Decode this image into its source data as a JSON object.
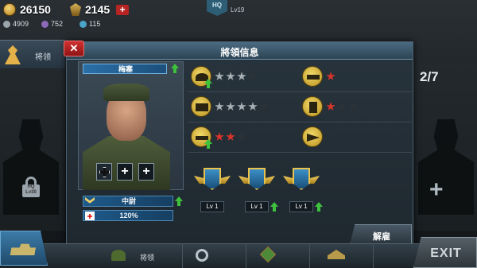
{
  "top_bar": {
    "gold": "26150",
    "medals": "2145",
    "resource_a": "4909",
    "resource_b": "752",
    "resource_c": "115",
    "hq_label": "HQ",
    "hq_level": "Lv19"
  },
  "left_tab": {
    "label": "将领"
  },
  "side": {
    "counter": "2/7",
    "lock_label": "HQ\nLv30"
  },
  "dialog": {
    "title": "將領信息",
    "close": "✕",
    "general_name": "梅塞",
    "rank": "中尉",
    "hp": "120%",
    "medal_slots": [
      "+",
      "+"
    ],
    "skills": [
      {
        "icon": "helmet-icon",
        "stars": [
          "gray",
          "gray",
          "gray",
          "dark"
        ],
        "upgrade": true
      },
      {
        "icon": "artillery-icon",
        "stars": [
          "red"
        ],
        "upgrade": false
      },
      {
        "icon": "tank-icon",
        "stars": [
          "gray",
          "gray",
          "gray",
          "gray",
          "dark"
        ],
        "upgrade": false
      },
      {
        "icon": "anchor-icon",
        "stars": [
          "red",
          "dark",
          "dark"
        ],
        "upgrade": false
      },
      {
        "icon": "plane-icon",
        "stars": [
          "red",
          "red",
          "dark"
        ],
        "upgrade": true
      },
      {
        "icon": "flag-icon",
        "stars": [],
        "upgrade": false
      }
    ],
    "badges": [
      {
        "level": "Lv 1",
        "upgrade": false
      },
      {
        "level": "Lv 1",
        "upgrade": true
      },
      {
        "level": "Lv 1",
        "upgrade": true
      }
    ],
    "dismiss": "解雇"
  },
  "bottom_bar": {
    "generals_tab": "将领",
    "exit": "EXIT"
  },
  "colors": {
    "accent_blue": "#2a6fa8",
    "star_red": "#d9342a",
    "upgrade_green": "#3ec23e",
    "close_red": "#b72424"
  }
}
